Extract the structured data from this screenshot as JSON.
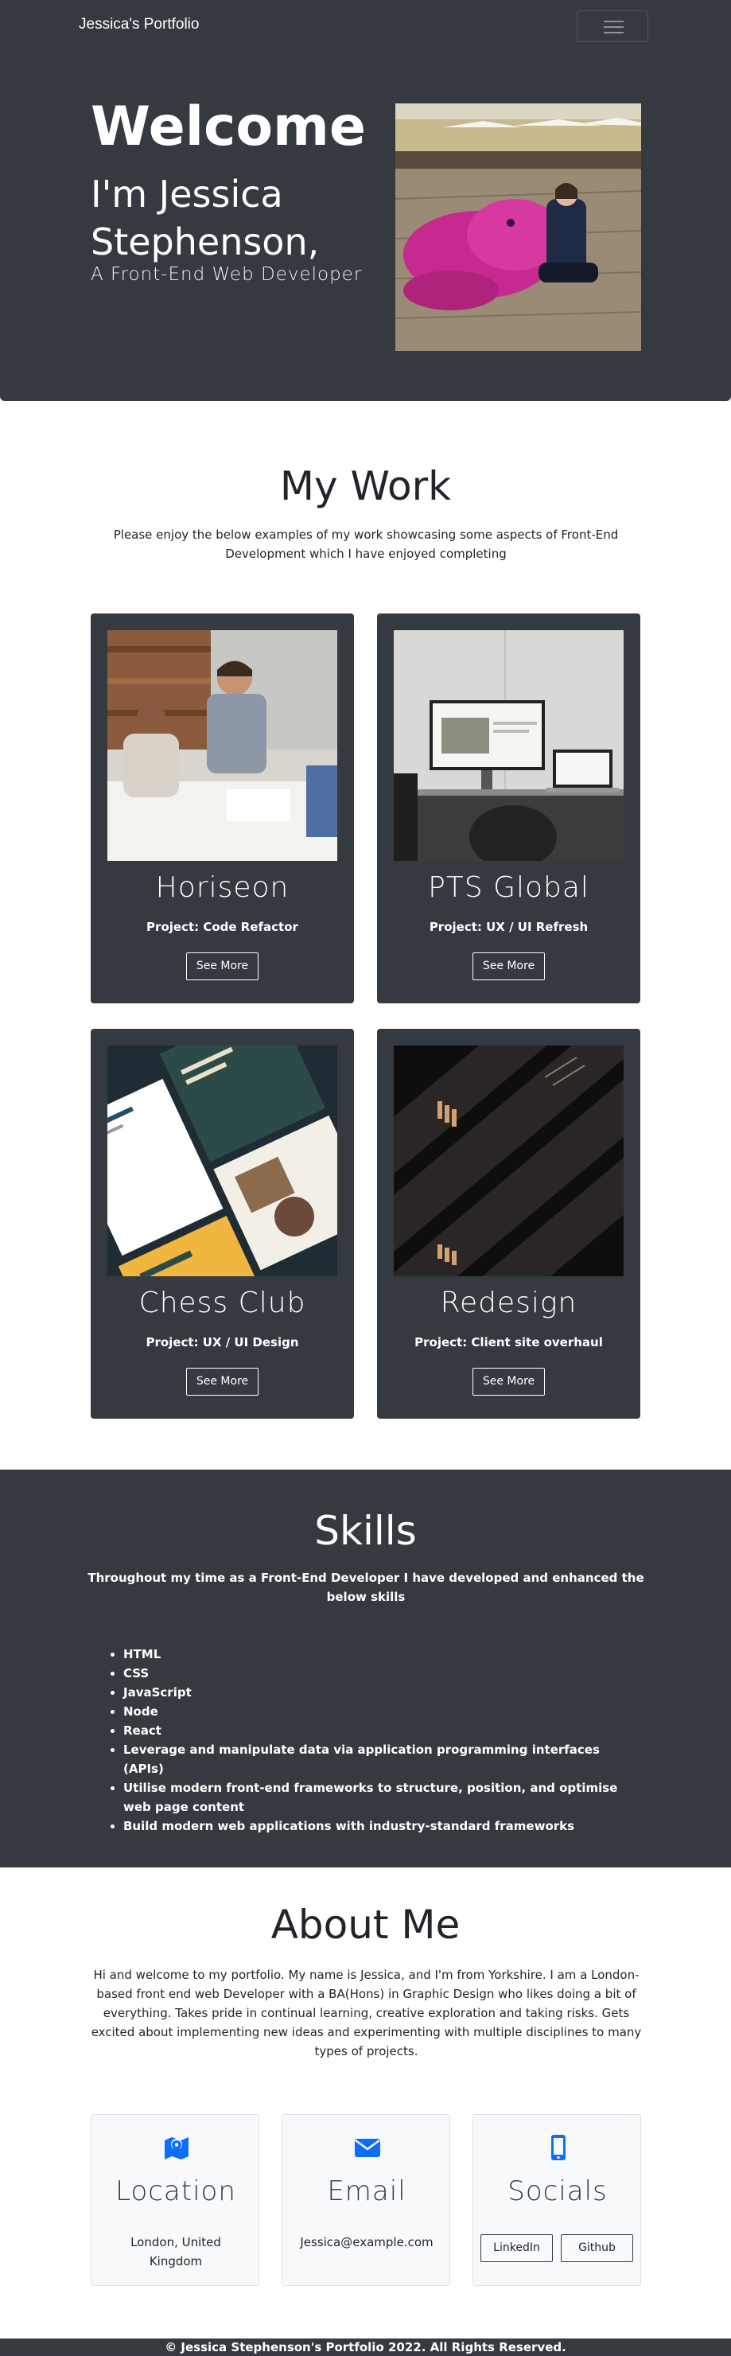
{
  "navbar": {
    "brand": "Jessica's Portfolio",
    "toggle_icon": "hamburger-menu-icon"
  },
  "hero": {
    "welcome": "Welcome",
    "name": "I'm Jessica Stephenson,",
    "subtitle": "A Front-End Web Developer"
  },
  "work": {
    "title": "My Work",
    "intro": "Please enjoy the below examples of my work showcasing some aspects of Front-End Development which I have enjoyed completing",
    "projects": [
      {
        "title": "Horiseon",
        "project": "Project: Code Refactor",
        "button": "See More"
      },
      {
        "title": "PTS Global",
        "project": "Project: UX / UI Refresh",
        "button": "See More"
      },
      {
        "title": "Chess Club",
        "project": "Project: UX / UI Design",
        "button": "See More"
      },
      {
        "title": "Redesign",
        "project": "Project: Client site overhaul",
        "button": "See More"
      }
    ]
  },
  "skills": {
    "title": "Skills",
    "intro": "Throughout my time as a Front-End Developer I have developed and enhanced the below skills",
    "items": [
      "HTML",
      "CSS",
      "JavaScript",
      "Node",
      "React",
      "Leverage and manipulate data via application programming interfaces (APIs)",
      "Utilise modern front-end frameworks to structure, position, and optimise web page content",
      "Build modern web applications with industry-standard frameworks"
    ]
  },
  "about": {
    "title": "About Me",
    "text": "Hi and welcome to my portfolio. My name is Jessica, and I'm from Yorkshire. I am a London-based front end web Developer with a BA(Hons) in Graphic Design who likes doing a bit of everything. Takes pride in continual learning, creative exploration and taking risks. Gets excited about implementing new ideas and experimenting with multiple disciplines to many types of projects.",
    "location": {
      "title": "Location",
      "value": "London, United Kingdom",
      "icon": "map-pin-icon"
    },
    "email": {
      "title": "Email",
      "value": "Jessica@example.com",
      "icon": "envelope-icon"
    },
    "socials": {
      "title": "Socials",
      "linkedin": "LinkedIn",
      "github": "Github",
      "icon": "mobile-phone-icon"
    }
  },
  "footer": {
    "text": "© Jessica Stephenson's Portfolio 2022. All Rights Reserved."
  },
  "colors": {
    "dark": "#343a40",
    "accent_blue": "#0d6efd",
    "light_box": "#f8f9fa"
  }
}
